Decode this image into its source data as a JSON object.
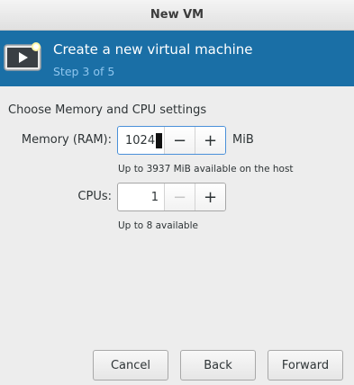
{
  "window": {
    "title": "New VM"
  },
  "header": {
    "icon": "vm-display-icon",
    "title": "Create a new virtual machine",
    "step": "Step 3 of 5"
  },
  "section_title": "Choose Memory and CPU settings",
  "memory": {
    "label": "Memory (RAM):",
    "value": "1024",
    "unit": "MiB",
    "hint": "Up to 3937 MiB available on the host",
    "decrement": "−",
    "increment": "+"
  },
  "cpus": {
    "label": "CPUs:",
    "value": "1",
    "hint": "Up to 8 available",
    "decrement": "−",
    "increment": "+",
    "decrement_enabled": false
  },
  "buttons": {
    "cancel": "Cancel",
    "back": "Back",
    "forward": "Forward"
  },
  "colors": {
    "header_bg": "#1a6fa6",
    "step_text": "#8fc6ee",
    "focus_border": "#4a90d9"
  }
}
